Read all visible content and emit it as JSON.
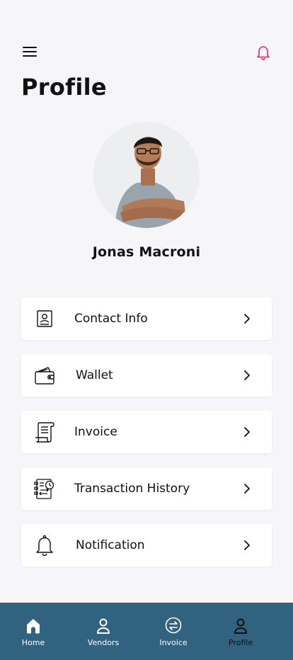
{
  "header": {
    "title": "Profile",
    "menu_icon": "hamburger-icon",
    "bell_icon": "bell-icon",
    "bell_color": "#e0267a"
  },
  "profile": {
    "name": "Jonas Macroni",
    "avatar": "profile-photo"
  },
  "menu": [
    {
      "label": "Contact Info",
      "icon": "contact-card-icon"
    },
    {
      "label": "Wallet",
      "icon": "wallet-icon"
    },
    {
      "label": "Invoice",
      "icon": "invoice-icon"
    },
    {
      "label": "Transaction History",
      "icon": "transaction-history-icon"
    },
    {
      "label": "Notification",
      "icon": "bell-icon"
    }
  ],
  "bottom_nav": {
    "background": "#31627f",
    "items": [
      {
        "label": "Home",
        "icon": "home-icon"
      },
      {
        "label": "Vendors",
        "icon": "user-icon"
      },
      {
        "label": "Invoice",
        "icon": "exchange-icon"
      },
      {
        "label": "Profile",
        "icon": "user-icon",
        "active": true
      }
    ]
  }
}
